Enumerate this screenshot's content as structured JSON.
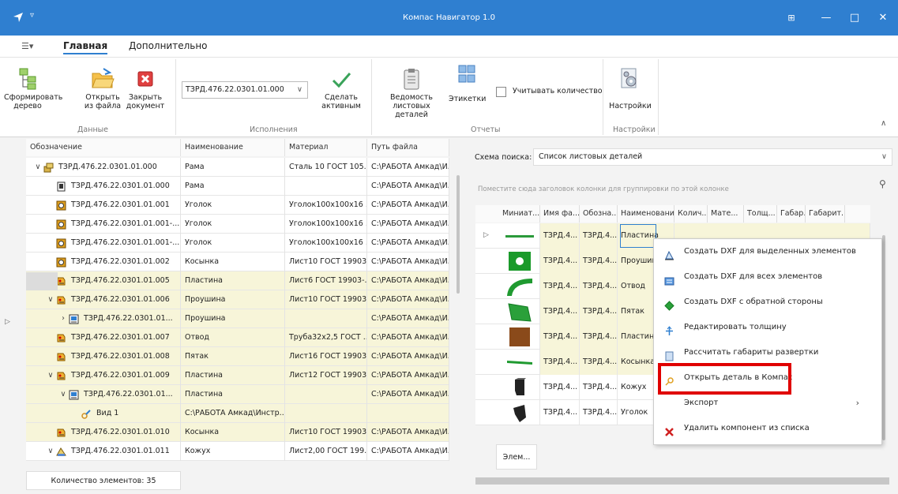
{
  "window": {
    "title": "Компас Навигатор 1.0"
  },
  "menu": {
    "tab_main": "Главная",
    "tab_extra": "Дополнительно"
  },
  "ribbon": {
    "build_tree": [
      "Сформировать",
      "дерево"
    ],
    "open_file": [
      "Открыть",
      "из файла"
    ],
    "close_doc": [
      "Закрыть",
      "документ"
    ],
    "group_data": "Данные",
    "execution_value": "ТЗРД.476.22.0301.01.000",
    "make_active": [
      "Сделать",
      "активным"
    ],
    "group_exec": "Исполнения",
    "sheet_list": [
      "Ведомость",
      "листовых деталей"
    ],
    "labels": "Этикетки",
    "count_check": "Учитывать количество",
    "group_reports": "Отчеты",
    "settings": "Настройки",
    "group_settings": "Настройки"
  },
  "tree": {
    "headers": [
      "Обозначение",
      "Наименование",
      "Материал",
      "Путь файла"
    ],
    "rows": [
      {
        "arrow": "∨",
        "icon": "assembly",
        "designation": "ТЗРД.476.22.0301.01.000",
        "name": "Рама",
        "material": "Сталь 10  ГОСТ 105...",
        "path": "C:\\РАБОТА Амкад\\И...",
        "indent": 0,
        "bg": "wh"
      },
      {
        "arrow": "",
        "icon": "document",
        "designation": "ТЗРД.476.22.0301.01.000",
        "name": "Рама",
        "material": "",
        "path": "C:\\РАБОТА Амкад\\И...",
        "indent": 1,
        "bg": "wh"
      },
      {
        "arrow": "",
        "icon": "part",
        "designation": "ТЗРД.476.22.0301.01.001",
        "name": "Уголок",
        "material": "Уголок100х100х16 ...",
        "path": "C:\\РАБОТА Амкад\\И...",
        "indent": 1,
        "bg": "wh"
      },
      {
        "arrow": "",
        "icon": "part",
        "designation": "ТЗРД.476.22.0301.01.001-...",
        "name": "Уголок",
        "material": "Уголок100х100х16 ...",
        "path": "C:\\РАБОТА Амкад\\И...",
        "indent": 1,
        "bg": "wh"
      },
      {
        "arrow": "",
        "icon": "part",
        "designation": "ТЗРД.476.22.0301.01.001-...",
        "name": "Уголок",
        "material": "Уголок100х100х16 ...",
        "path": "C:\\РАБОТА Амкад\\И...",
        "indent": 1,
        "bg": "wh"
      },
      {
        "arrow": "",
        "icon": "part",
        "designation": "ТЗРД.476.22.0301.01.002",
        "name": "Косынка",
        "material": "Лист10 ГОСТ 19903...",
        "path": "C:\\РАБОТА Амкад\\И...",
        "indent": 1,
        "bg": "wh"
      },
      {
        "arrow": "",
        "icon": "sheet",
        "designation": "ТЗРД.476.22.0301.01.005",
        "name": "Пластина",
        "material": "Лист6 ГОСТ 19903-...",
        "path": "C:\\РАБОТА Амкад\\И...",
        "indent": 1,
        "bg": "yl"
      },
      {
        "arrow": "∨",
        "icon": "sheet",
        "designation": "ТЗРД.476.22.0301.01.006",
        "name": "Проушина",
        "material": "Лист10 ГОСТ 19903...",
        "path": "C:\\РАБОТА Амкад\\И...",
        "indent": 1,
        "bg": "yl"
      },
      {
        "arrow": "›",
        "icon": "drawing",
        "designation": "ТЗРД.476.22.0301.01...",
        "name": "Проушина",
        "material": "",
        "path": "C:\\РАБОТА Амкад\\И...",
        "indent": 2,
        "bg": "yl"
      },
      {
        "arrow": "",
        "icon": "sheet",
        "designation": "ТЗРД.476.22.0301.01.007",
        "name": "Отвод",
        "material": "Труба32х2,5 ГОСТ ...",
        "path": "C:\\РАБОТА Амкад\\И...",
        "indent": 1,
        "bg": "yl"
      },
      {
        "arrow": "",
        "icon": "sheet",
        "designation": "ТЗРД.476.22.0301.01.008",
        "name": "Пятак",
        "material": "Лист16 ГОСТ 19903...",
        "path": "C:\\РАБОТА Амкад\\И...",
        "indent": 1,
        "bg": "yl"
      },
      {
        "arrow": "∨",
        "icon": "sheet",
        "designation": "ТЗРД.476.22.0301.01.009",
        "name": "Пластина",
        "material": "Лист12 ГОСТ 19903...",
        "path": "C:\\РАБОТА Амкад\\И...",
        "indent": 1,
        "bg": "yl"
      },
      {
        "arrow": "∨",
        "icon": "drawing",
        "designation": "ТЗРД.476.22.0301.01...",
        "name": "Пластина",
        "material": "",
        "path": "C:\\РАБОТА Амкад\\И...",
        "indent": 2,
        "bg": "yl"
      },
      {
        "arrow": "",
        "icon": "view",
        "designation": "Вид 1",
        "name": "C:\\РАБОТА Амкад\\Инстр...",
        "material": "",
        "path": "",
        "indent": 3,
        "bg": "yl"
      },
      {
        "arrow": "",
        "icon": "sheet",
        "designation": "ТЗРД.476.22.0301.01.010",
        "name": "Косынка",
        "material": "Лист10 ГОСТ 19903...",
        "path": "C:\\РАБОТА Амкад\\И...",
        "indent": 1,
        "bg": "yl"
      },
      {
        "arrow": "∨",
        "icon": "assembly2",
        "designation": "ТЗРД.476.22.0301.01.011",
        "name": "Кожух",
        "material": "Лист2,00 ГОСТ 199...",
        "path": "C:\\РАБОТА Амкад\\И...",
        "indent": 1,
        "bg": "wh"
      }
    ],
    "count_label": "Количество элементов: 35"
  },
  "right": {
    "search_label": "Схема поиска:",
    "search_value": "Список листовых деталей",
    "group_hint": "Поместите сюда заголовок колонки для группировки по этой колонке",
    "headers": [
      "Миниат...",
      "Имя фа...",
      "Обозна...",
      "Наименование",
      "Колич...",
      "Мате...",
      "Толщ...",
      "Габар...",
      "Габарит..."
    ],
    "rows": [
      {
        "thumb": "plate-thin",
        "file": "ТЗРД.4...",
        "desig": "ТЗРД.4...",
        "name": "Пластина",
        "bg": "yl"
      },
      {
        "thumb": "lug",
        "file": "ТЗРД.4...",
        "desig": "ТЗРД.4...",
        "name": "Проушин",
        "bg": "yl"
      },
      {
        "thumb": "bend",
        "file": "ТЗРД.4...",
        "desig": "ТЗРД.4...",
        "name": "Отвод",
        "bg": "yl"
      },
      {
        "thumb": "patch",
        "file": "ТЗРД.4...",
        "desig": "ТЗРД.4...",
        "name": "Пятак",
        "bg": "yl"
      },
      {
        "thumb": "plate-brown",
        "file": "ТЗРД.4...",
        "desig": "ТЗРД.4...",
        "name": "Пластин",
        "bg": "yl"
      },
      {
        "thumb": "gusset",
        "file": "ТЗРД.4...",
        "desig": "ТЗРД.4...",
        "name": "Косынка",
        "bg": "yl"
      },
      {
        "thumb": "cover",
        "file": "ТЗРД.4...",
        "desig": "ТЗРД.4...",
        "name": "Кожух",
        "bg": "wh"
      },
      {
        "thumb": "angle",
        "file": "ТЗРД.4...",
        "desig": "ТЗРД.4...",
        "name": "Уголок",
        "bg": "wh"
      }
    ],
    "footer_btn": "Элем..."
  },
  "context_menu": [
    {
      "icon": "dxf-selected-icon",
      "label": "Создать DXF для выделенных элементов"
    },
    {
      "icon": "dxf-all-icon",
      "label": "Создать DXF для всех элементов"
    },
    {
      "icon": "dxf-reverse-icon",
      "label": "Создать DXF с обратной стороны"
    },
    {
      "icon": "thickness-icon",
      "label": "Редактировать толщину"
    },
    {
      "icon": "calc-icon",
      "label": "Рассчитать габариты развертки"
    },
    {
      "icon": "open-key-icon",
      "label": "Открыть деталь в Компас"
    },
    {
      "icon": "",
      "label": "Экспорт"
    },
    {
      "icon": "delete-icon",
      "label": "Удалить компонент из списка"
    }
  ],
  "colors": {
    "title": "#2f7fd0",
    "highlight": "#e00000",
    "row_yellow": "#f7f5d9"
  }
}
